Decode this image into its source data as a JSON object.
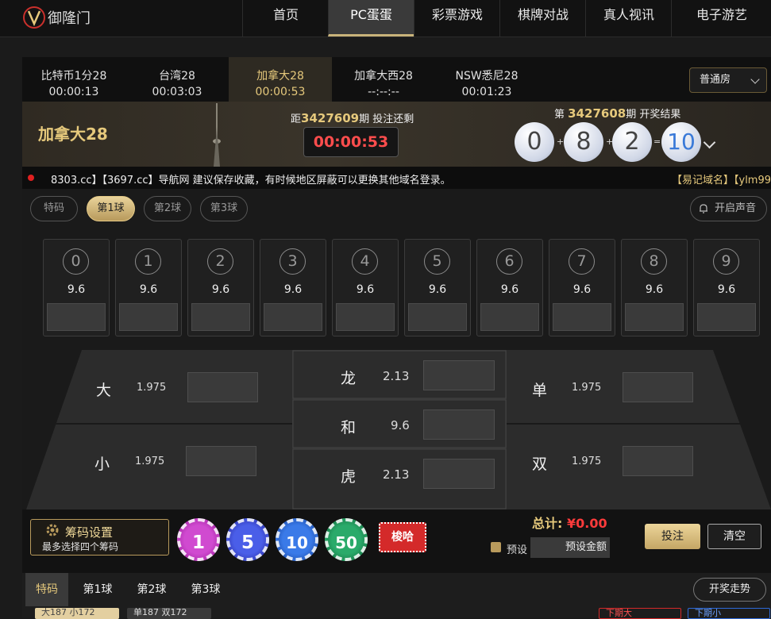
{
  "brand": "御隆门",
  "nav": [
    "首页",
    "PC蛋蛋",
    "彩票游戏",
    "棋牌对战",
    "真人视讯",
    "电子游艺"
  ],
  "lottery_tabs": [
    {
      "name": "比特币1分28",
      "time": "00:00:13"
    },
    {
      "name": "台湾28",
      "time": "00:03:03"
    },
    {
      "name": "加拿大28",
      "time": "00:00:53"
    },
    {
      "name": "加拿大西28",
      "time": "--:--:--"
    },
    {
      "name": "NSW悉尼28",
      "time": "00:01:23"
    }
  ],
  "room": "普通房",
  "banner": {
    "lottery_name": "加拿大28",
    "countdown_prefix": "距",
    "countdown_period": "3427609",
    "countdown_suffix": "期 投注还剩",
    "countdown": "00:00:53",
    "result_prefix": "第 ",
    "result_period": "3427608",
    "result_suffix": "期 开奖结果",
    "balls": [
      "0",
      "8",
      "2",
      "10"
    ],
    "ops": [
      "+",
      "+",
      "="
    ]
  },
  "marquee": {
    "text": "8303.cc】【3697.cc】导航网 建议保存收藏，有时候地区屏蔽可以更换其他域名登录。",
    "right": "【易记域名】【ylm99"
  },
  "ball_tabs": [
    "特码",
    "第1球",
    "第2球",
    "第3球"
  ],
  "sound_button": "开启声音",
  "numbers": [
    {
      "n": "0",
      "odds": "9.6"
    },
    {
      "n": "1",
      "odds": "9.6"
    },
    {
      "n": "2",
      "odds": "9.6"
    },
    {
      "n": "3",
      "odds": "9.6"
    },
    {
      "n": "4",
      "odds": "9.6"
    },
    {
      "n": "5",
      "odds": "9.6"
    },
    {
      "n": "6",
      "odds": "9.6"
    },
    {
      "n": "7",
      "odds": "9.6"
    },
    {
      "n": "8",
      "odds": "9.6"
    },
    {
      "n": "9",
      "odds": "9.6"
    }
  ],
  "bets": {
    "big": {
      "label": "大",
      "odds": "1.975"
    },
    "small": {
      "label": "小",
      "odds": "1.975"
    },
    "dragon": {
      "label": "龙",
      "odds": "2.13"
    },
    "tie": {
      "label": "和",
      "odds": "9.6"
    },
    "tiger": {
      "label": "虎",
      "odds": "2.13"
    },
    "odd": {
      "label": "单",
      "odds": "1.975"
    },
    "even": {
      "label": "双",
      "odds": "1.975"
    }
  },
  "chips": {
    "settings_title": "筹码设置",
    "settings_sub": "最多选择四个筹码",
    "values": [
      "1",
      "5",
      "10",
      "50"
    ],
    "suoha": "梭哈"
  },
  "total_label": "总计: ",
  "total_value": "¥0.00",
  "preset_label": "预设",
  "preset_button": "预设金额",
  "bet_button": "投注",
  "clear_button": "清空",
  "result_tabs": [
    "特码",
    "第1球",
    "第2球",
    "第3球"
  ],
  "trend_button": "开奖走势",
  "stats": [
    "大187 小172",
    "单187 双172",
    "下期大",
    "下期小"
  ],
  "colors": {
    "gold": "#e6c97c",
    "red": "#ff4d4d",
    "chip1": "#c83ac8",
    "chip5": "#3a4ed8",
    "chip10": "#2e6ad8",
    "chip50": "#1f9a5a"
  }
}
